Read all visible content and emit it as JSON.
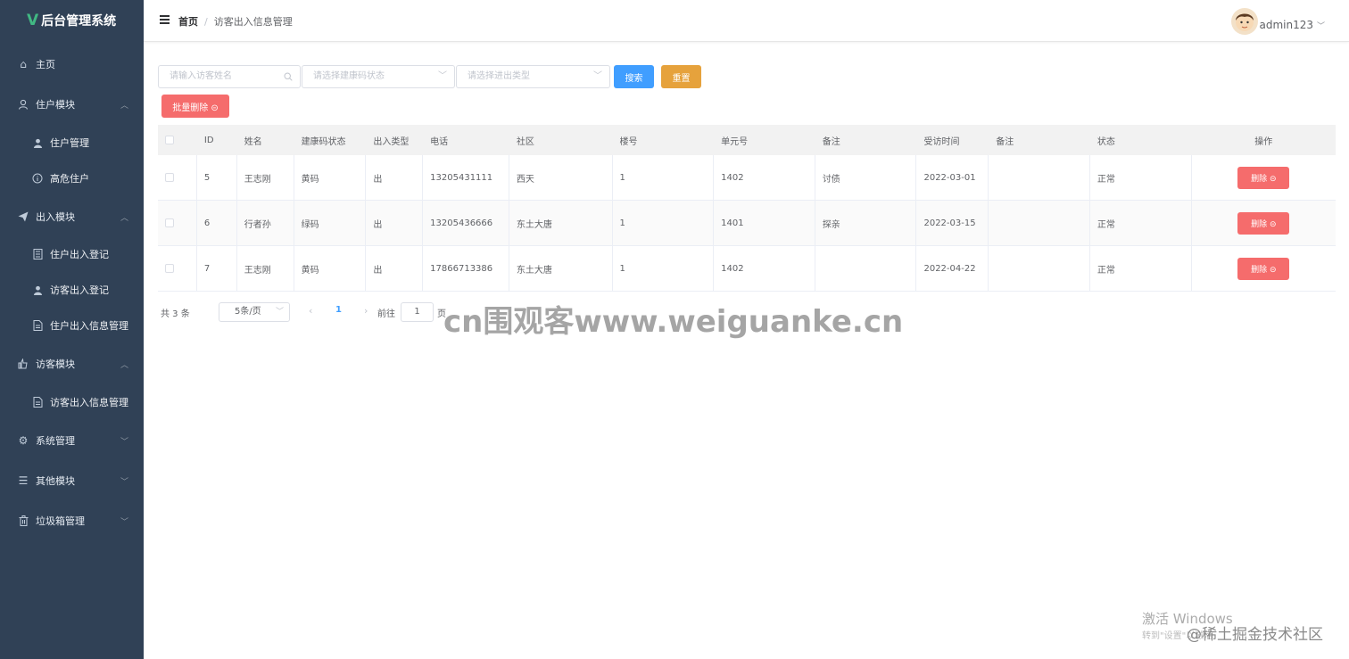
{
  "app": {
    "logo_glyph": "V",
    "title": "后台管理系统"
  },
  "sidebar": {
    "items": [
      {
        "label": "主页",
        "icon": "home-icon",
        "arrow": ""
      },
      {
        "label": "住户模块",
        "icon": "user-icon",
        "arrow": "up"
      },
      {
        "label": "住户管理",
        "icon": "person-icon",
        "sub": true
      },
      {
        "label": "高危住户",
        "icon": "info-icon",
        "sub": true
      },
      {
        "label": "出入模块",
        "icon": "send-icon",
        "arrow": "up"
      },
      {
        "label": "住户出入登记",
        "icon": "notebook-icon",
        "sub": true
      },
      {
        "label": "访客出入登记",
        "icon": "person-icon",
        "sub": true
      },
      {
        "label": "住户出入信息管理",
        "icon": "document-icon",
        "sub": true
      },
      {
        "label": "访客模块",
        "icon": "pointer-icon",
        "arrow": "up"
      },
      {
        "label": "访客出入信息管理",
        "icon": "document-icon",
        "sub": true
      },
      {
        "label": "系统管理",
        "icon": "gear-icon",
        "arrow": "down"
      },
      {
        "label": "其他模块",
        "icon": "menu-icon",
        "arrow": "down"
      },
      {
        "label": "垃圾箱管理",
        "icon": "trash-icon",
        "arrow": "down"
      }
    ]
  },
  "header": {
    "breadcrumb_home": "首页",
    "breadcrumb_sep": "/",
    "breadcrumb_current": "访客出入信息管理",
    "username": "admin123"
  },
  "filters": {
    "name_placeholder": "请输入访客姓名",
    "health_placeholder": "请选择建康码状态",
    "type_placeholder": "请选择进出类型",
    "search_label": "搜索",
    "reset_label": "重置",
    "batch_delete_label": "批量删除 ⊝"
  },
  "table": {
    "headers": [
      "ID",
      "姓名",
      "建康码状态",
      "出入类型",
      "电话",
      "社区",
      "楼号",
      "单元号",
      "备注",
      "受访时间",
      "备注",
      "状态",
      "操作"
    ],
    "rows": [
      {
        "id": "5",
        "name": "王志刚",
        "code": "黄码",
        "type": "出",
        "phone": "13205431111",
        "community": "西天",
        "building": "1",
        "unit": "1402",
        "note": "讨债",
        "time": "2022-03-01",
        "note2": "",
        "status": "正常"
      },
      {
        "id": "6",
        "name": "行者孙",
        "code": "绿码",
        "type": "出",
        "phone": "13205436666",
        "community": "东土大唐",
        "building": "1",
        "unit": "1401",
        "note": "探亲",
        "time": "2022-03-15",
        "note2": "",
        "status": "正常"
      },
      {
        "id": "7",
        "name": "王志刚",
        "code": "黄码",
        "type": "出",
        "phone": "17866713386",
        "community": "东土大唐",
        "building": "1",
        "unit": "1402",
        "note": "",
        "time": "2022-04-22",
        "note2": "",
        "status": "正常"
      }
    ],
    "delete_label": "删除 ⊝"
  },
  "pagination": {
    "total": "共 3 条",
    "page_size": "5条/页",
    "current_page": "1",
    "goto_prefix": "前往",
    "goto_value": "1",
    "goto_suffix": "页"
  },
  "overlays": {
    "watermark": "cn围观客www.weiguanke.cn",
    "windows_line1": "激活 Windows",
    "windows_line2": "转到\"设置\"以激活",
    "juejin": "@稀土掘金技术社区"
  },
  "colors": {
    "sidebar_bg": "#304156",
    "primary": "#409eff",
    "warning": "#e6a23c",
    "danger": "#f56c6c"
  }
}
